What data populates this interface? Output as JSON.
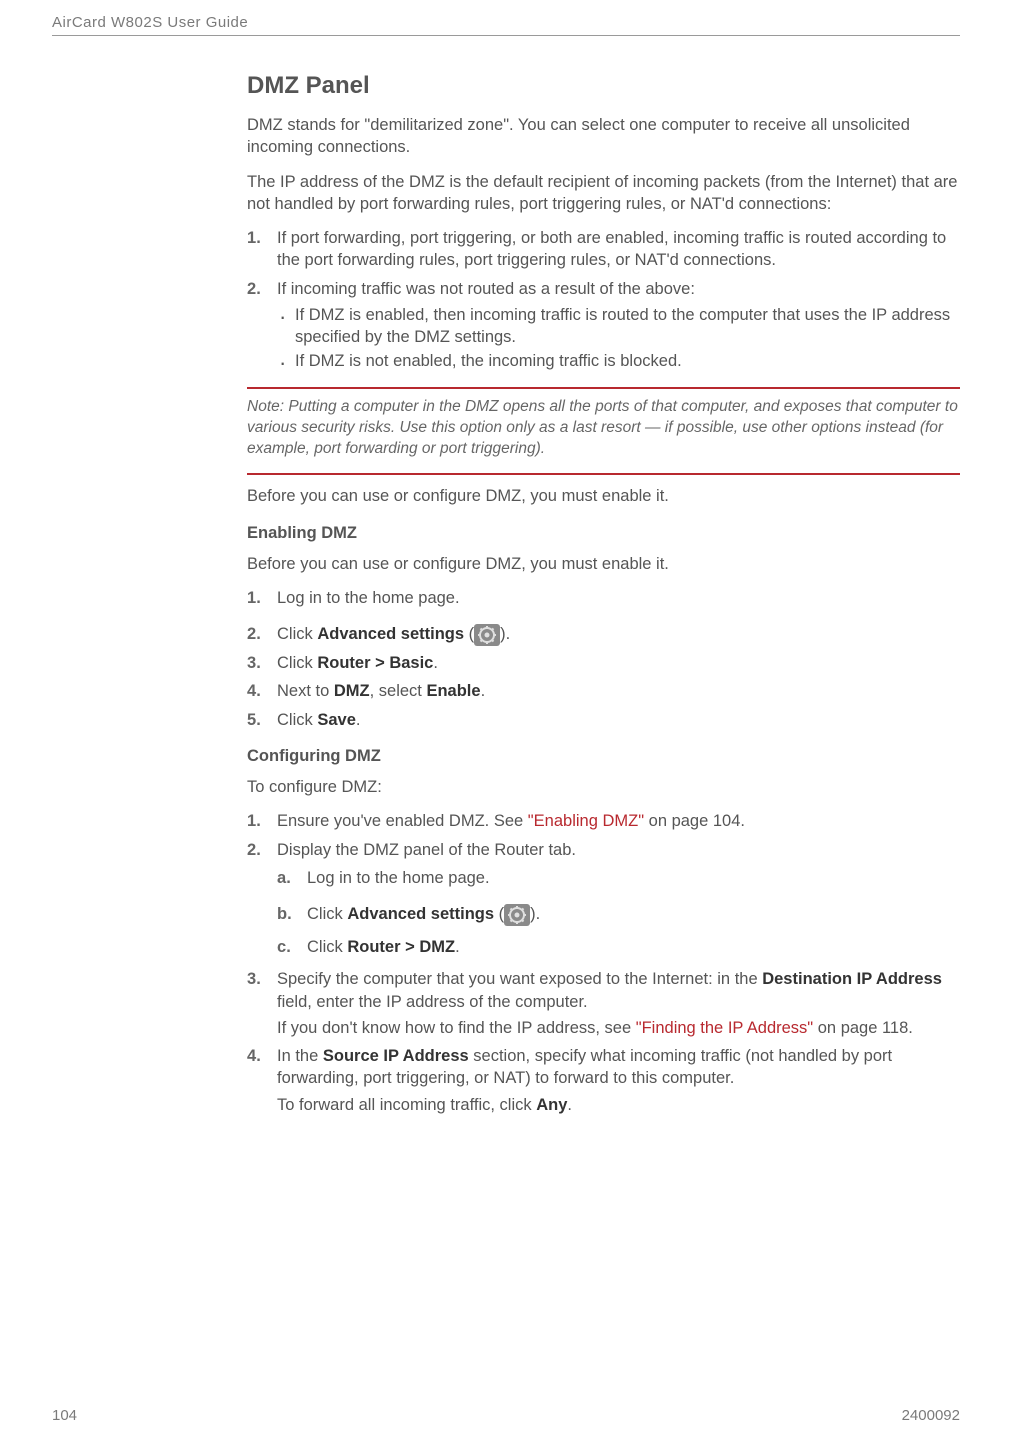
{
  "header": {
    "docTitle": "AirCard W802S User Guide"
  },
  "section": {
    "h2": "DMZ Panel",
    "p1": "DMZ stands for \"demilitarized zone\". You can select one computer to receive all unsolicited incoming connections.",
    "p2": "The IP address of the DMZ is the default recipient of incoming packets (from the Internet) that are not handled by port forwarding rules, port triggering rules, or NAT'd connections:",
    "ol1": {
      "i1": "If port forwarding, port triggering, or both are enabled, incoming traffic is routed according to the port forwarding rules, port triggering rules, or NAT'd connections.",
      "i2": "If incoming traffic was not routed as a result of the above:",
      "i2b1": "If DMZ is enabled, then incoming traffic is routed to the computer that uses the IP address specified by the DMZ settings.",
      "i2b2": "If DMZ is not enabled, the incoming traffic is blocked."
    },
    "noteLabel": "Note:  ",
    "noteText": "Putting a computer in the DMZ opens all the ports of that computer, and exposes that computer to various security risks. Use this option only as a last resort — if possible, use other options instead (for example, port forwarding or port triggering).",
    "p3": "Before you can use or configure DMZ, you must enable it.",
    "h3a": "Enabling DMZ",
    "p4": "Before you can use or configure DMZ, you must enable it.",
    "olEnable": {
      "i1": "Log in to the home page.",
      "i2a": "Click ",
      "i2b": "Advanced settings",
      "i2c": " (",
      "i2d": ").",
      "i3a": "Click ",
      "i3b": "Router > Basic",
      "i3c": ".",
      "i4a": "Next to ",
      "i4b": "DMZ",
      "i4c": ", select ",
      "i4d": "Enable",
      "i4e": ".",
      "i5a": "Click ",
      "i5b": "Save",
      "i5c": "."
    },
    "h3b": "Configuring DMZ",
    "p5": "To configure DMZ:",
    "olCfg": {
      "i1a": "Ensure you've enabled DMZ. See ",
      "i1link": "\"Enabling DMZ\"",
      "i1b": " on page 104.",
      "i2": "Display the DMZ panel of the Router tab.",
      "i2a": "Log in to the home page.",
      "i2b1": "Click ",
      "i2b2": "Advanced settings",
      "i2b3": " (",
      "i2b4": ").",
      "i2c1": "Click ",
      "i2c2": "Router > DMZ",
      "i2c3": ".",
      "i3a": "Specify the computer that you want exposed to the Internet: in the ",
      "i3b": "Destination IP Address",
      "i3c": " field, enter the IP address of the computer.",
      "i3d": "If you don't know how to find the IP address, see ",
      "i3link": "\"Finding the IP Address\"",
      "i3e": " on page 118.",
      "i4a": "In the ",
      "i4b": "Source IP Address",
      "i4c": " section, specify what incoming traffic (not handled by port forwarding, port triggering, or NAT) to forward to this computer.",
      "i4d": "To forward all incoming traffic, click ",
      "i4e": "Any",
      "i4f": "."
    }
  },
  "footer": {
    "pageNum": "104",
    "docNum": "2400092"
  }
}
